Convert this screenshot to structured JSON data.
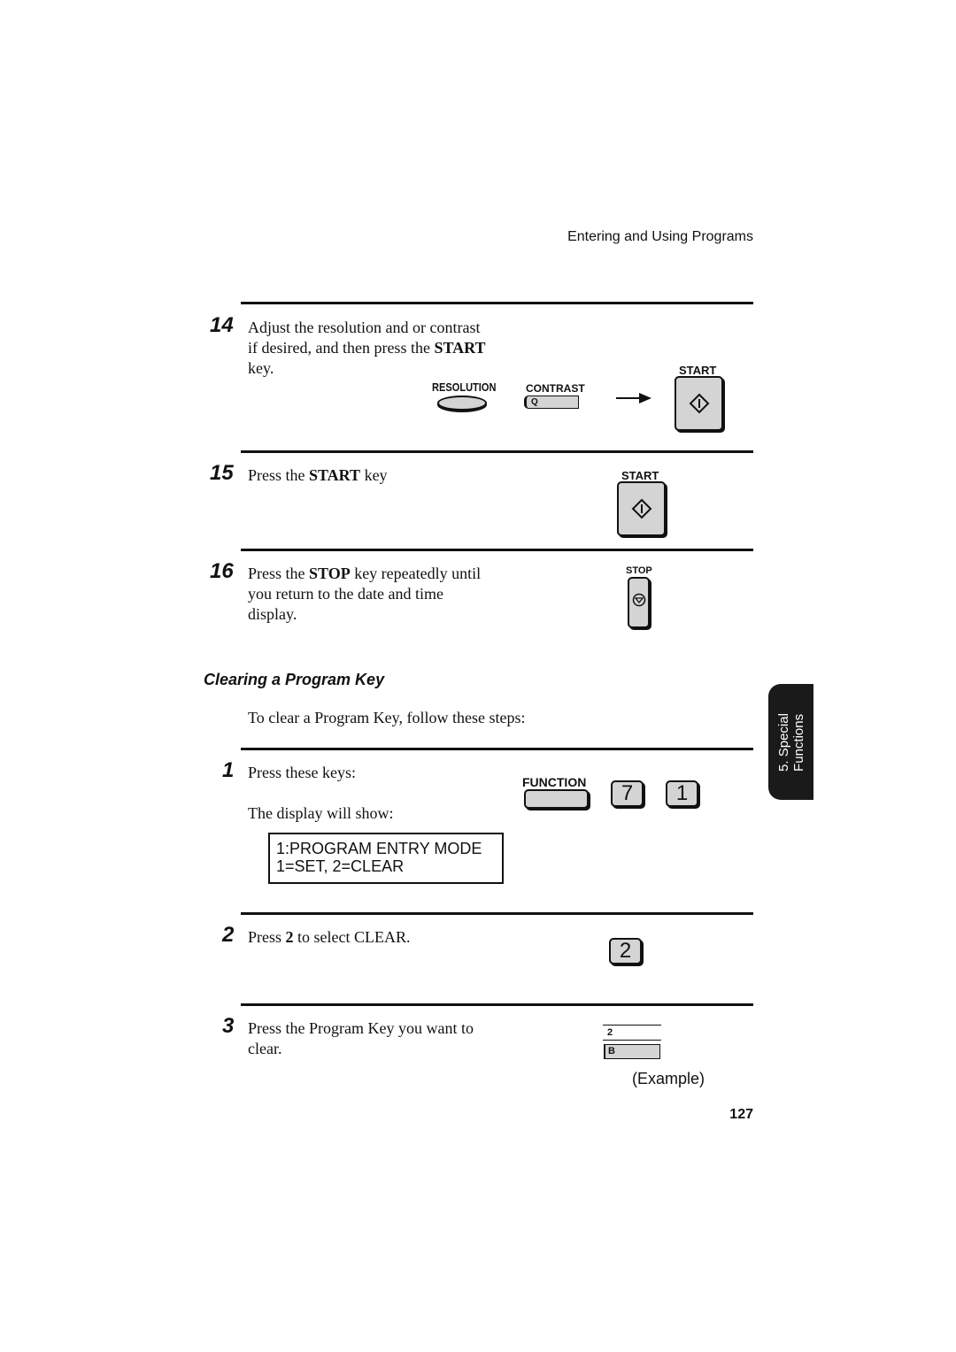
{
  "header": {
    "title": "Entering and Using Programs"
  },
  "steps_section1": [
    {
      "number": "14",
      "text_lines": [
        "Adjust the resolution and or contrast",
        "if desired, and then press the",
        "key."
      ],
      "bold_word": "START",
      "keys": {
        "resolution_label": "RESOLUTION",
        "contrast_label": "CONTRAST",
        "contrast_key_letter": "Q",
        "start_label": "START"
      }
    },
    {
      "number": "15",
      "text_prefix": "Press the",
      "bold_word": "START",
      "text_suffix": "key",
      "keys": {
        "start_label": "START"
      }
    },
    {
      "number": "16",
      "text_prefix": "Press the",
      "bold_word": "STOP",
      "text_suffix": "key repeatedly until",
      "text_lines": [
        "you return to the date and time",
        "display."
      ],
      "keys": {
        "stop_label": "STOP"
      }
    }
  ],
  "section": {
    "heading": "Clearing a Program Key",
    "intro": "To clear a Program Key, follow these steps:"
  },
  "steps_section2": [
    {
      "number": "1",
      "text": "Press these keys:",
      "subtext": "The display will show:",
      "keys": {
        "function_label": "FUNCTION",
        "key1": "7",
        "key2": "1"
      },
      "display": {
        "line1": "1:PROGRAM ENTRY MODE",
        "line2": "1=SET, 2=CLEAR"
      }
    },
    {
      "number": "2",
      "text_prefix": "Press",
      "bold_word": "2",
      "text_suffix": "to select CLEAR.",
      "keys": {
        "key": "2"
      }
    },
    {
      "number": "3",
      "text_lines": [
        "Press the Program Key you want to",
        "clear."
      ],
      "program_key": {
        "number_label": "2",
        "letter_label": "B"
      },
      "example_label": "(Example)"
    }
  ],
  "side_tab": {
    "line1": "5. Special",
    "line2": "Functions"
  },
  "page_number": "127"
}
